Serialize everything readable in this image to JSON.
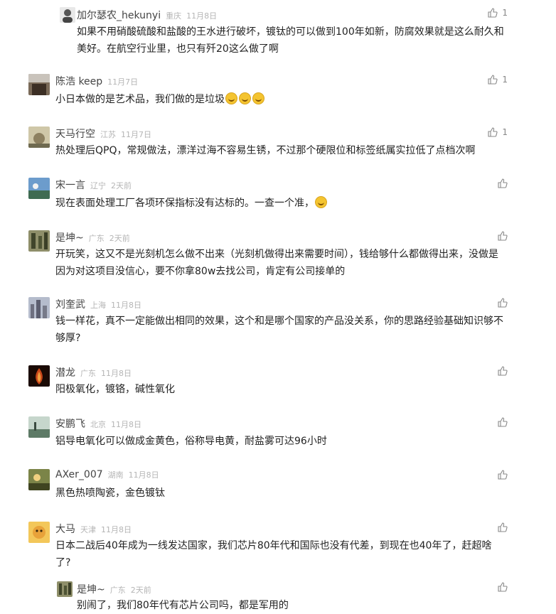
{
  "comments": [
    {
      "user": "加尔瑟农_hekunyi",
      "location": "重庆",
      "time": "11月8日",
      "text": "如果不用硝酸硫酸和盐酸的王水进行破坏，镀钛的可以做到100年如新，防腐效果就是这么耐久和美好。在航空行业里，也只有歼20这么做了啊",
      "likes": "1",
      "avatar_color": "#6c6c6c"
    },
    {
      "user": "陈浩 keep",
      "location": "",
      "time": "11月7日",
      "text": "小日本做的是艺术品，我们做的是垃圾",
      "likes": "1",
      "avatar_color": "#5a4838"
    },
    {
      "user": "天马行空",
      "location": "江苏",
      "time": "11月7日",
      "text": "热处理后QPQ，常规做法，漂洋过海不容易生锈，不过那个硬限位和标签纸属实拉低了点档次啊",
      "likes": "1",
      "avatar_color": "#a39a7c"
    },
    {
      "user": "宋一言",
      "location": "辽宁",
      "time": "2天前",
      "text": "现在表面处理工厂各项环保指标没有达标的。一查一个准，",
      "likes": "",
      "avatar_color": "#4f7da6"
    },
    {
      "user": "是坤~",
      "location": "广东",
      "time": "2天前",
      "text": "开玩笑，这又不是光刻机怎么做不出来（光刻机做得出来需要时间），钱给够什么都做得出来，没做是因为对这项目没信心，要不你拿80w去找公司，肯定有公司接单的",
      "likes": "",
      "avatar_color": "#6b7250"
    },
    {
      "user": "刘奎武",
      "location": "上海",
      "time": "11月8日",
      "text": "钱一样花，真不一定能做出相同的效果，这个和是哪个国家的产品没关系，你的思路经验基础知识够不够厚?",
      "likes": "",
      "avatar_color": "#8a93a8"
    },
    {
      "user": "潜龙",
      "location": "广东",
      "time": "11月8日",
      "text": "阳极氧化，镀铬，碱性氧化",
      "likes": "",
      "avatar_color": "#3a1608"
    },
    {
      "user": "安鹏飞",
      "location": "北京",
      "time": "11月8日",
      "text": "铝导电氧化可以做成金黄色，俗称导电黄，耐盐雾可达96小时",
      "likes": "",
      "avatar_color": "#8aa39a"
    },
    {
      "user": "AXer_007",
      "location": "湖南",
      "time": "11月8日",
      "text": "黑色热喷陶瓷，金色镀钛",
      "likes": "",
      "avatar_color": "#55603a"
    },
    {
      "user": "大马",
      "location": "天津",
      "time": "11月8日",
      "text": "日本二战后40年成为一线发达国家，我们芯片80年代和国际也没有代差，到现在也40年了，赶超啥了?",
      "likes": "",
      "avatar_color": "#e0b24a"
    },
    {
      "user": "是坤~",
      "location": "广东",
      "time": "2天前",
      "text": "别闹了，我们80年代有芯片公司吗，都是军用的",
      "likes": "",
      "avatar_color": "#6b7250"
    }
  ],
  "icons": {
    "like": "thumbs-up-icon",
    "emoji_laugh": "laughing-emoji",
    "emoji_smile": "smile-emoji"
  }
}
